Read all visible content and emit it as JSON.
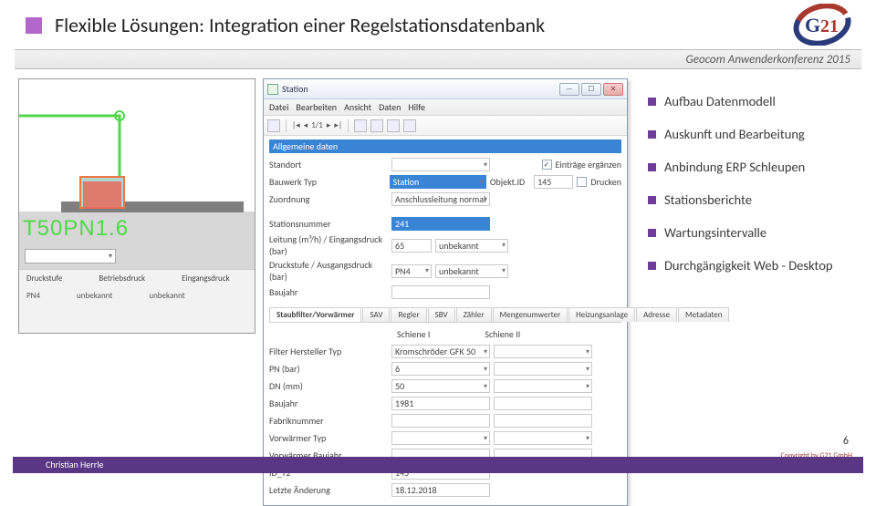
{
  "slide": {
    "title": "Flexible Lösungen: Integration einer Regelstationsdatenbank",
    "subtitle": "Geocom Anwenderkonferenz 2015",
    "page": "6",
    "author": "Christian Herrle",
    "copyright": "Copyright by G21 GmbH"
  },
  "logo": {
    "text_g": "G",
    "text_21": "21"
  },
  "bullets": [
    "Aufbau Datenmodell",
    "Auskunft und Bearbeitung",
    "Anbindung ERP Schleupen",
    "Stationsberichte",
    "Wartungsintervalle",
    "Durchgängigkeit Web - Desktop"
  ],
  "map": {
    "label": "T50PN1.6",
    "col1": {
      "hdr": "Druckstufe",
      "val": "PN4"
    },
    "col2": {
      "hdr": "Betriebsdruck",
      "val": "unbekannt"
    },
    "col3": {
      "hdr": "Eingangsdruck",
      "val": "unbekannt"
    }
  },
  "win": {
    "title": "Station",
    "menus": [
      "Datei",
      "Bearbeiten",
      "Ansicht",
      "Daten",
      "Hilfe"
    ],
    "nav": {
      "pos": "1/1"
    },
    "section_label": "Allgemeine daten",
    "right_actions": {
      "entries": "Einträge ergänzen",
      "print": "Drucken"
    },
    "rows": {
      "standort_label": "Standort",
      "bauwerktyp_label": "Bauwerk Typ",
      "bauwerktyp_val": "Station",
      "objektid_label": "Objekt.ID",
      "objektid_val": "145",
      "zuordnung_label": "Zuordnung",
      "zuordnung_val": "Anschlussleitung normal",
      "stationsnr_label": "Stationsnummer",
      "stationsnr_val": "241",
      "leitung_label": "Leitung (m³/h) / Eingangsdruck (bar)",
      "leitung_val": "65",
      "leitung_note": "unbekannt",
      "druckstufe_label": "Druckstufe / Ausgangsdruck (bar)",
      "druckstufe_val": "PN4",
      "druckstufe_note": "unbekannt",
      "baujahr_label": "Baujahr"
    },
    "tabs": [
      "Staubfilter/Vorwärmer",
      "SAV",
      "Regler",
      "SBV",
      "Zähler",
      "Mengenumwerter",
      "Heizungsanlage",
      "Adresse",
      "Metadaten"
    ],
    "schiene": {
      "s1": "Schiene I",
      "s2": "Schiene II"
    },
    "detail": {
      "filter_label": "Filter Hersteller Typ",
      "filter_val": "Kromschröder GFK 50",
      "pn_label": "PN (bar)",
      "pn_val": "6",
      "dn_label": "DN (mm)",
      "dn_val": "50",
      "baujahr_label": "Baujahr",
      "baujahr_val": "1981",
      "fabrik_label": "Fabriknummer",
      "vorw_typ_label": "Vorwärmer Typ",
      "vorw_bj_label": "Vorwärmer Baujahr",
      "id_label": "ID_T2",
      "id_val": "145",
      "letzte_label": "Letzte Änderung",
      "letzte_val": "18.12.2018"
    }
  }
}
